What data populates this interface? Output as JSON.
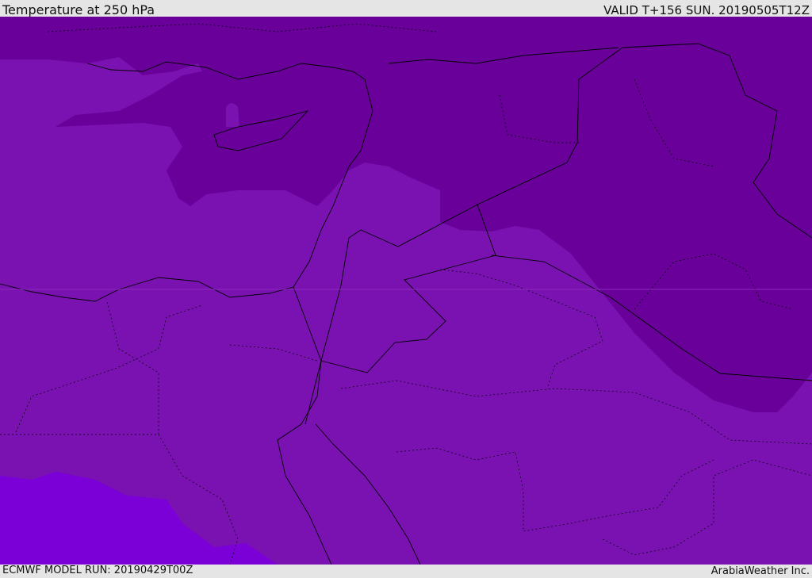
{
  "header": {
    "title": "Temperature at 250 hPa",
    "valid": "VALID T+156 SUN. 20190505T12Z"
  },
  "footer": {
    "model_run": "ECMWF MODEL RUN: 20190429T00Z",
    "credit": "ArabiaWeather Inc."
  },
  "colors": {
    "warm_band": "#7a12b2",
    "cold_band": "#680099",
    "colder_band": "#7b00d8",
    "border": "#000000",
    "frame": "#e5e5e5"
  }
}
